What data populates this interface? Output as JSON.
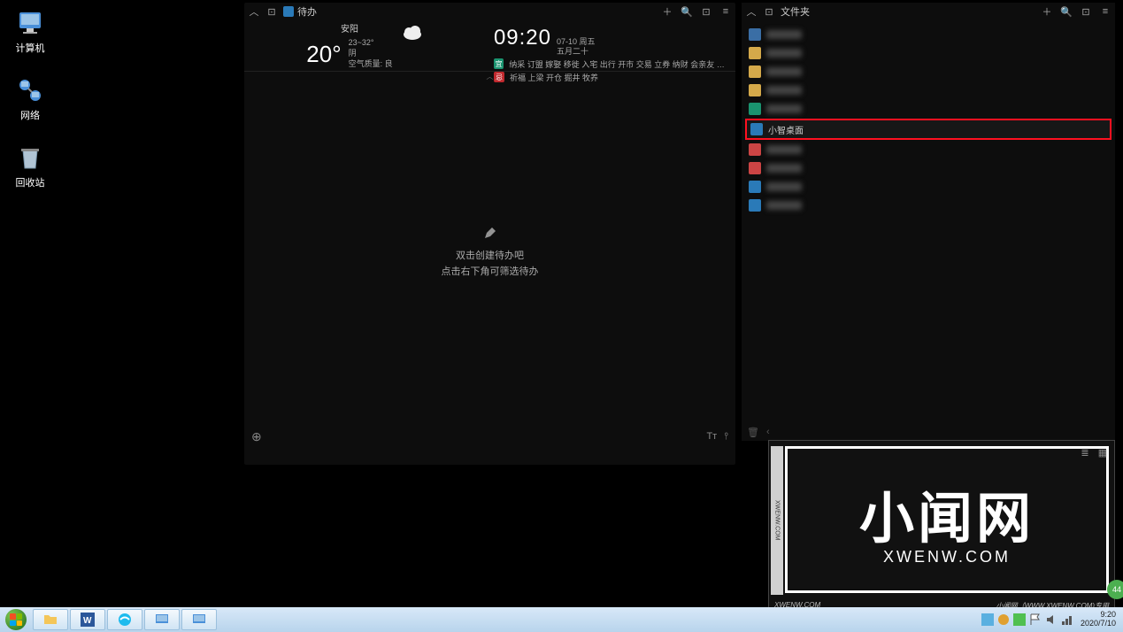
{
  "desktop": {
    "icons": [
      {
        "label": "计算机"
      },
      {
        "label": "网络"
      },
      {
        "label": "回收站"
      }
    ]
  },
  "todo_panel": {
    "title": "待办",
    "empty_line1": "双击创建待办吧",
    "empty_line2": "点击右下角可筛选待办"
  },
  "weather": {
    "city": "安阳",
    "temp": "20°",
    "range": "23~32°",
    "condition": "阴",
    "air": "空气质量: 良"
  },
  "datetime": {
    "time": "09:20",
    "date": "07-10",
    "weekday": "周五",
    "lunar": "五月二十"
  },
  "almanac": {
    "yi": "纳采 订盟 嫁娶 移徙 入宅 出行 开市 交易 立券 纳财 会亲友 安香...",
    "ji": "祈福 上梁 开仓 掘井 牧养"
  },
  "folder_panel": {
    "title": "文件夹",
    "items": [
      {
        "icon": "#3a6ea5",
        "blurred": true
      },
      {
        "icon": "#d4a94a",
        "blurred": true
      },
      {
        "icon": "#d4a94a",
        "blurred": true
      },
      {
        "icon": "#d4a94a",
        "blurred": true
      },
      {
        "icon": "#1a936f",
        "blurred": true
      },
      {
        "icon": "#2a7ab8",
        "name": "小智桌面",
        "highlighted": true
      },
      {
        "icon": "#c44",
        "blurred": true
      },
      {
        "icon": "#c44",
        "blurred": true
      },
      {
        "icon": "#2a7ab8",
        "blurred": true
      },
      {
        "icon": "#2a7ab8",
        "blurred": true
      }
    ]
  },
  "watermark": {
    "big": "小闻网",
    "url": "XWENW.COM",
    "tag": "XWENW.COM",
    "footer_left": "XWENW.COM",
    "footer_right": "小闻网（WWW.XWENW.COM)专用"
  },
  "green_badge": "44",
  "taskbar": {
    "time": "9:20",
    "date": "2020/7/10"
  }
}
